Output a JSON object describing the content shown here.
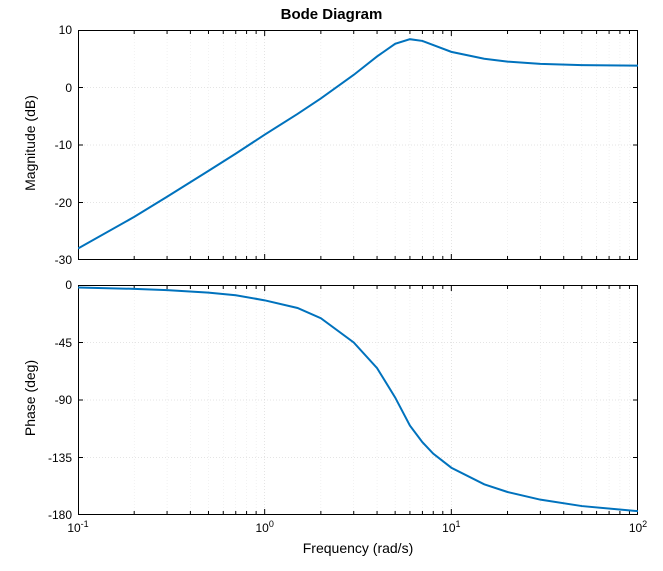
{
  "title": "Bode Diagram",
  "xlabel": "Frequency (rad/s)",
  "magnitude": {
    "ylabel": "Magnitude (dB)",
    "yticks": [
      -30,
      -20,
      -10,
      0,
      10
    ],
    "ytick_labels": [
      "-30",
      "-20",
      "-10",
      "0",
      "10"
    ]
  },
  "phase": {
    "ylabel": "Phase (deg)",
    "yticks": [
      -180,
      -135,
      -90,
      -45,
      0
    ],
    "ytick_labels": [
      "-180",
      "-135",
      "-90",
      "-45",
      "0"
    ]
  },
  "xticks_exp": [
    -1,
    0,
    1,
    2
  ],
  "xtick_labels": [
    "10^{-1}",
    "10^{0}",
    "10^{1}",
    "10^{2}"
  ],
  "chart_data": [
    {
      "type": "line",
      "title": "Bode Diagram — Magnitude",
      "xlabel": "Frequency (rad/s)",
      "ylabel": "Magnitude (dB)",
      "xscale": "log",
      "xlim": [
        0.1,
        100
      ],
      "ylim": [
        -30,
        10
      ],
      "series": [
        {
          "name": "Magnitude",
          "x": [
            0.1,
            0.2,
            0.3,
            0.5,
            0.7,
            1.0,
            1.5,
            2.0,
            3.0,
            4.0,
            5.0,
            6.0,
            7.0,
            10,
            15,
            20,
            30,
            50,
            100
          ],
          "values": [
            -28,
            -22.5,
            -19.0,
            -14.5,
            -11.5,
            -8.2,
            -4.6,
            -1.9,
            2.2,
            5.4,
            7.6,
            8.4,
            8.1,
            6.2,
            5.0,
            4.5,
            4.1,
            3.9,
            3.8
          ]
        }
      ]
    },
    {
      "type": "line",
      "title": "Bode Diagram — Phase",
      "xlabel": "Frequency (rad/s)",
      "ylabel": "Phase (deg)",
      "xscale": "log",
      "xlim": [
        0.1,
        100
      ],
      "ylim": [
        -180,
        0
      ],
      "series": [
        {
          "name": "Phase",
          "x": [
            0.1,
            0.2,
            0.3,
            0.5,
            0.7,
            1.0,
            1.5,
            2.0,
            3.0,
            4.0,
            5.0,
            6.0,
            7.0,
            8.0,
            10,
            15,
            20,
            30,
            50,
            100
          ],
          "values": [
            -2,
            -3,
            -4,
            -6,
            -8,
            -12,
            -18,
            -26,
            -45,
            -65,
            -88,
            -110,
            -123,
            -132,
            -143,
            -156,
            -162,
            -168,
            -173,
            -177
          ]
        }
      ]
    }
  ]
}
